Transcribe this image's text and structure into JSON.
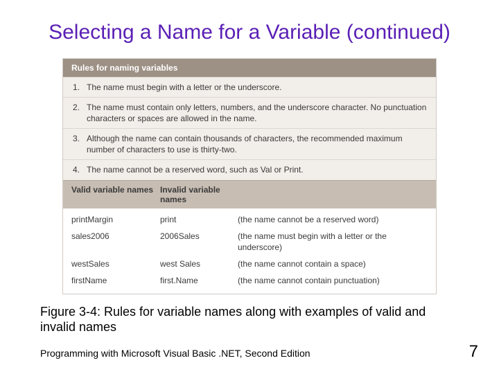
{
  "title": "Selecting a Name for a Variable (continued)",
  "rulesHeader": "Rules for naming variables",
  "rules": [
    {
      "num": "1.",
      "text": "The name must begin with a letter or the underscore."
    },
    {
      "num": "2.",
      "text": "The name must contain only letters, numbers, and the underscore character. No punctuation characters or spaces are allowed in the name."
    },
    {
      "num": "3.",
      "text": "Although the name can contain thousands of characters, the recommended maximum number of characters to use is thirty-two."
    },
    {
      "num": "4.",
      "text": "The name cannot be a reserved word, such as Val or Print."
    }
  ],
  "validHeader": "Valid variable names",
  "invalidHeader": "Invalid variable names",
  "examples": [
    {
      "valid": "printMargin",
      "invalid": "print",
      "reason": "(the name cannot be a reserved word)"
    },
    {
      "valid": "sales2006",
      "invalid": "2006Sales",
      "reason": "(the name must begin with a letter or the underscore)"
    },
    {
      "valid": "westSales",
      "invalid": "west Sales",
      "reason": "(the name cannot contain a space)"
    },
    {
      "valid": "firstName",
      "invalid": "first.Name",
      "reason": "(the name cannot contain punctuation)"
    }
  ],
  "caption": "Figure 3-4: Rules for variable names along with examples of valid and invalid names",
  "footer": "Programming with Microsoft Visual Basic .NET, Second Edition",
  "pageNumber": "7"
}
